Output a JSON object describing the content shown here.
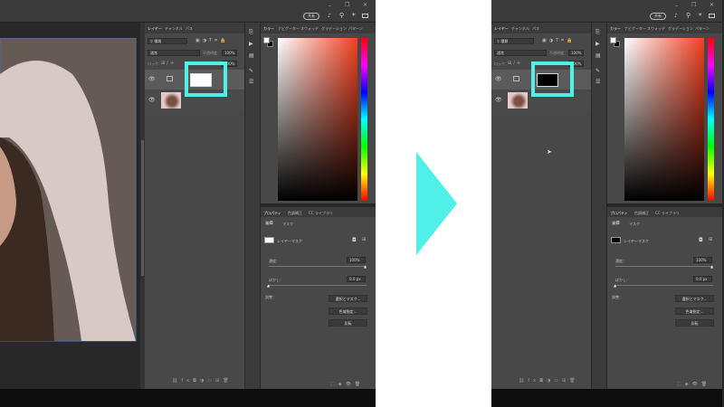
{
  "screens": [
    {
      "share_label": "共有",
      "layers_tab": "レイヤー",
      "channels_tab": "チャンネル",
      "paths_tab": "パス",
      "filter_kind": "種類",
      "blend_mode": "通常",
      "opacity_label": "不透明度：",
      "opacity_value": "100%",
      "lock_label": "ロック：",
      "fill_value": "100%",
      "color_tab": "カラー",
      "navigator_tab": "ナビゲーター",
      "swatches_tab": "スウォッチ",
      "gradients_tab": "グラデーション",
      "patterns_tab": "パターン",
      "properties_tab": "プロパティ",
      "adjustments_tab": "色調補正",
      "libraries_tab": "CC ライブラリ",
      "mask_label": "マスク",
      "layer_mask_label": "レイヤーマスク",
      "density_label": "濃度：",
      "density_value": "100%",
      "feather_label": "ぼかし：",
      "feather_value": "0.0 px",
      "adjust_label": "調整：",
      "select_mask_button": "選択とマスク...",
      "color_range_button": "色域指定...",
      "invert_button": "反転",
      "mask_color": "#ffffff"
    },
    {
      "share_label": "共有",
      "layers_tab": "レイヤー",
      "channels_tab": "チャンネル",
      "paths_tab": "パス",
      "filter_kind": "種類",
      "blend_mode": "通常",
      "opacity_label": "不透明度：",
      "opacity_value": "100%",
      "lock_label": "ロック：",
      "fill_value": "100%",
      "color_tab": "カラー",
      "navigator_tab": "ナビゲーター",
      "swatches_tab": "スウォッチ",
      "gradients_tab": "グラデーション",
      "patterns_tab": "パターン",
      "properties_tab": "プロパティ",
      "adjustments_tab": "色調補正",
      "libraries_tab": "CC ライブラリ",
      "mask_label": "マスク",
      "layer_mask_label": "レイヤーマスク",
      "density_label": "濃度：",
      "density_value": "100%",
      "feather_label": "ぼかし：",
      "feather_value": "0.0 px",
      "adjust_label": "調整：",
      "select_mask_button": "選択とマスク...",
      "color_range_button": "色域指定...",
      "invert_button": "反転",
      "mask_color": "#000000"
    }
  ],
  "highlight_color": "#4ef0e8",
  "arrow_color": "#4ef0e8"
}
